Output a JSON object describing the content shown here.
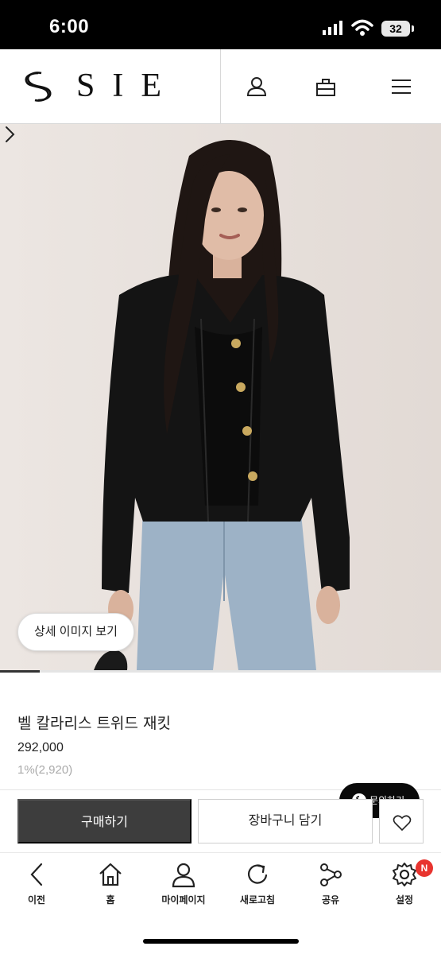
{
  "status_bar": {
    "time": "6:00",
    "battery": "32"
  },
  "header": {
    "brand": "SIE"
  },
  "hero": {
    "detail_button": "상세 이미지 보기",
    "slide_progress": 0.09
  },
  "product": {
    "name": "벨 칼라리스 트위드 재킷",
    "price": "292,000",
    "points": "1%(2,920)"
  },
  "actions": {
    "inquiry": "문의하기",
    "buy": "구매하기",
    "cart": "장바구니 담기"
  },
  "bottom_nav": {
    "items": [
      {
        "label": "이전",
        "icon": "back-icon"
      },
      {
        "label": "홈",
        "icon": "home-icon"
      },
      {
        "label": "마이페이지",
        "icon": "person-icon"
      },
      {
        "label": "새로고침",
        "icon": "refresh-icon"
      },
      {
        "label": "공유",
        "icon": "share-icon"
      },
      {
        "label": "설정",
        "icon": "gear-icon"
      }
    ],
    "settings_badge": "N"
  },
  "colors": {
    "buy_button": "#3d3d3d",
    "inquiry_button": "#0a0a0a",
    "badge": "#e8342f"
  }
}
